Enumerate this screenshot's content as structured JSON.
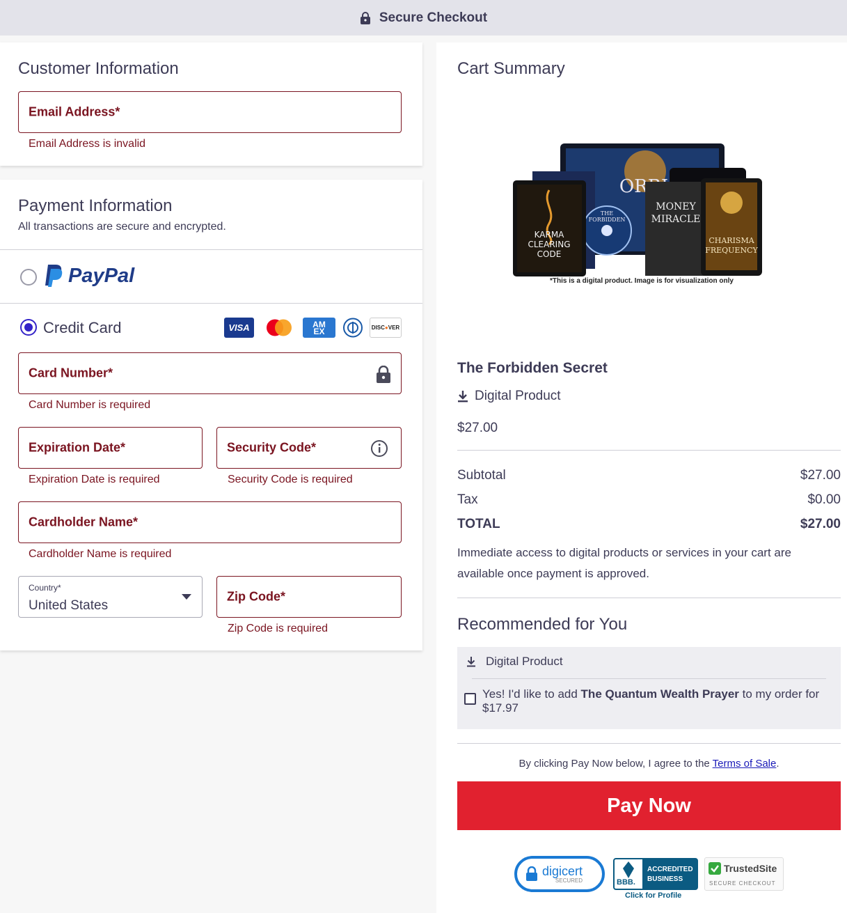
{
  "header": {
    "title": "Secure Checkout",
    "icon": "lock-icon"
  },
  "customer": {
    "title": "Customer Information",
    "email_label": "Email Address*",
    "email_error": "Email Address is invalid"
  },
  "payment": {
    "title": "Payment Information",
    "subtitle": "All transactions are secure and encrypted.",
    "paypal_label": "PayPal",
    "credit_card_label": "Credit Card",
    "card_brands": [
      "visa",
      "mastercard",
      "amex",
      "diners",
      "discover"
    ],
    "card_number_label": "Card Number*",
    "card_number_error": "Card Number is required",
    "expiration_label": "Expiration Date*",
    "expiration_error": "Expiration Date is required",
    "security_label": "Security Code*",
    "security_error": "Security Code is required",
    "cardholder_label": "Cardholder Name*",
    "cardholder_error": "Cardholder Name is required",
    "country_label": "Country*",
    "country_value": "United States",
    "zip_label": "Zip Code*",
    "zip_error": "Zip Code is required"
  },
  "cart": {
    "title": "Cart Summary",
    "image_caption": "*This is a digital product. Image is for visualization only",
    "product_name": "The Forbidden Secret",
    "product_type": "Digital Product",
    "product_price": "$27.00",
    "subtotal_label": "Subtotal",
    "subtotal_value": "$27.00",
    "tax_label": "Tax",
    "tax_value": "$0.00",
    "total_label": "TOTAL",
    "total_value": "$27.00",
    "access_note": "Immediate access to digital products or services in your cart are available once payment is approved."
  },
  "recommended": {
    "title": "Recommended for You",
    "type": "Digital Product",
    "offer_prefix": "Yes! I'd like to add ",
    "offer_product": "The Quantum Wealth Prayer",
    "offer_suffix": " to my order for $17.97"
  },
  "checkout": {
    "terms_prefix": "By clicking Pay Now below, I agree to the ",
    "terms_link": "Terms of Sale",
    "terms_suffix": ".",
    "pay_button": "Pay Now"
  },
  "badges": {
    "digicert": "digicert",
    "digicert_sub": "SECURED",
    "bbb_line1": "ACCREDITED",
    "bbb_line2": "BUSINESS",
    "bbb_logo": "BBB.",
    "bbb_link": "Click for Profile",
    "trustedsite": "TrustedSite",
    "trustedsite_sub": "SECURE CHECKOUT"
  },
  "colors": {
    "accent": "#3323c8",
    "error": "#7a1420",
    "pay": "#e1212f",
    "text": "#3d3b56"
  }
}
